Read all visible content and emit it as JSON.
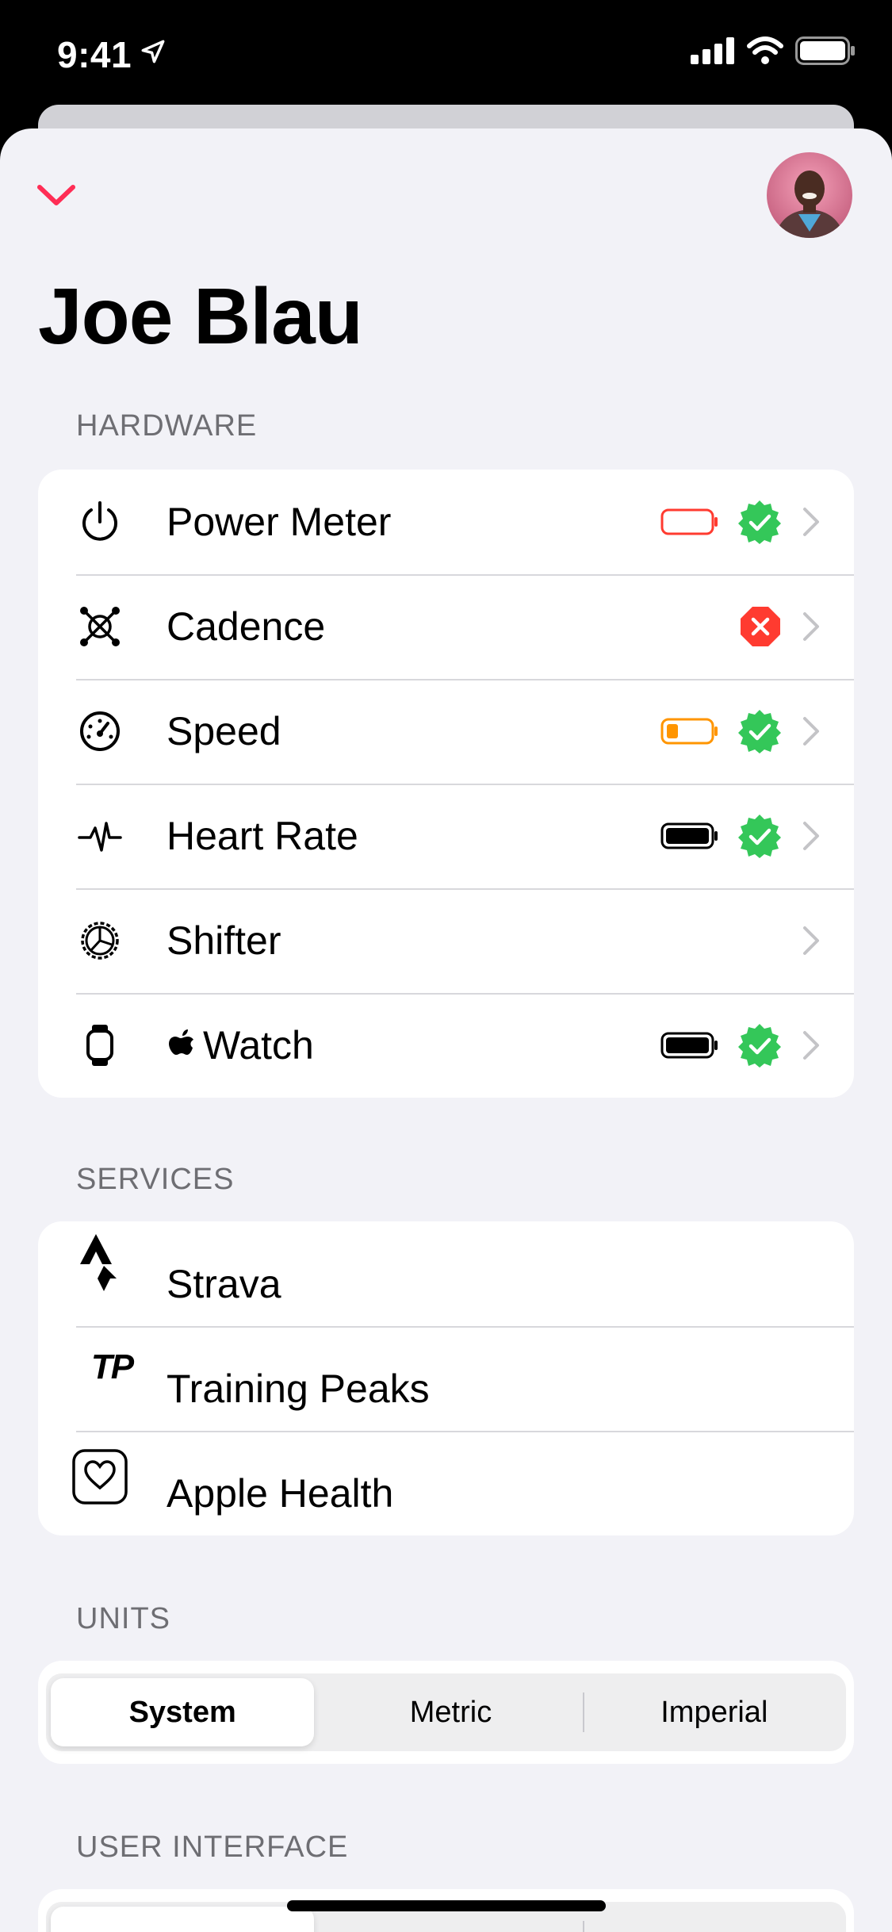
{
  "status_bar": {
    "time": "9:41"
  },
  "profile": {
    "name": "Joe Blau"
  },
  "hardware": {
    "header": "HARDWARE",
    "items": [
      {
        "label": "Power Meter",
        "icon": "power-icon",
        "battery": "low",
        "status": "connected"
      },
      {
        "label": "Cadence",
        "icon": "cadence-icon",
        "battery": "none",
        "status": "error"
      },
      {
        "label": "Speed",
        "icon": "speedometer-icon",
        "battery": "medium",
        "status": "connected"
      },
      {
        "label": "Heart Rate",
        "icon": "heart-rate-icon",
        "battery": "full",
        "status": "connected"
      },
      {
        "label": "Shifter",
        "icon": "shifter-icon",
        "battery": "none",
        "status": "none"
      },
      {
        "label": "Watch",
        "icon": "watch-icon",
        "battery": "full",
        "status": "connected"
      }
    ]
  },
  "services": {
    "header": "SERVICES",
    "items": [
      {
        "label": "Strava",
        "icon": "strava-icon"
      },
      {
        "label": "Training Peaks",
        "icon": "training-peaks-icon",
        "logo_text": "TP"
      },
      {
        "label": "Apple Health",
        "icon": "apple-health-icon"
      }
    ]
  },
  "units": {
    "header": "UNITS",
    "options": [
      "System",
      "Metric",
      "Imperial"
    ],
    "selected": "System"
  },
  "user_interface": {
    "header": "USER INTERFACE"
  },
  "colors": {
    "accent": "#ff2d55",
    "success": "#34c759",
    "error": "#ff3b30",
    "warning": "#ff9500",
    "background": "#f2f2f7"
  }
}
